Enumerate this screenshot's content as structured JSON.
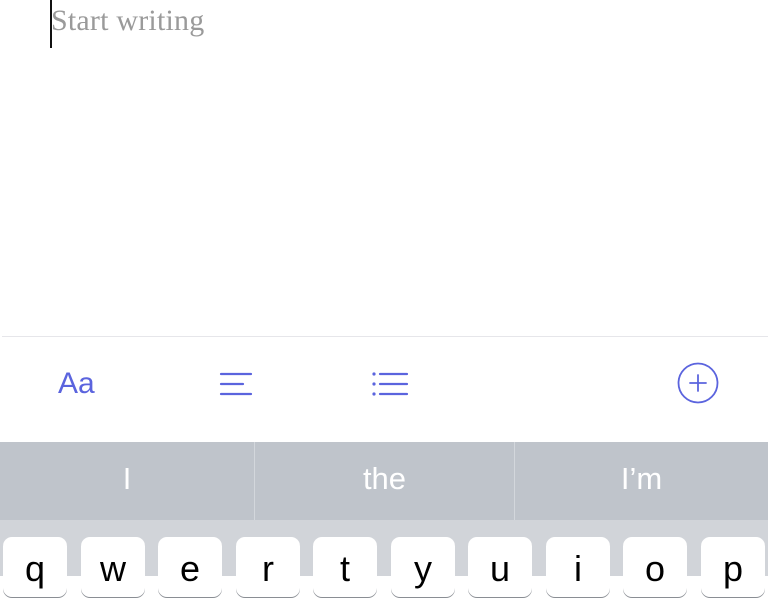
{
  "editor": {
    "placeholder": "Start writing"
  },
  "toolbar": {
    "font_label": "Aa",
    "icons": [
      "align-left-icon",
      "bullet-list-icon",
      "plus-circle-icon"
    ],
    "accent_color": "#5b64de"
  },
  "suggestions": [
    "I",
    "the",
    "I’m"
  ],
  "keyboard": {
    "row1": [
      "q",
      "w",
      "e",
      "r",
      "t",
      "y",
      "u",
      "i",
      "o",
      "p"
    ]
  }
}
